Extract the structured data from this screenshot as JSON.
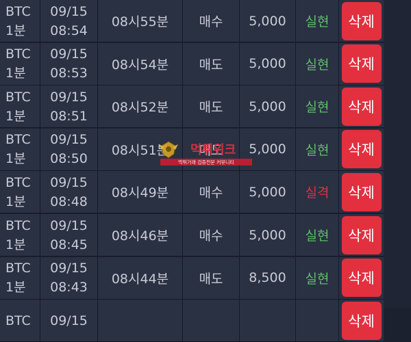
{
  "rows": [
    {
      "symbol": "BTC",
      "interval": "1분",
      "date": "09/15",
      "clock": "08:54",
      "round": "08시55분",
      "side": "매수",
      "amount": "5,000",
      "result": "실현",
      "result_type": "win",
      "action": "삭제"
    },
    {
      "symbol": "BTC",
      "interval": "1분",
      "date": "09/15",
      "clock": "08:53",
      "round": "08시54분",
      "side": "매도",
      "amount": "5,000",
      "result": "실현",
      "result_type": "win",
      "action": "삭제"
    },
    {
      "symbol": "BTC",
      "interval": "1분",
      "date": "09/15",
      "clock": "08:51",
      "round": "08시52분",
      "side": "매도",
      "amount": "5,000",
      "result": "실현",
      "result_type": "win",
      "action": "삭제"
    },
    {
      "symbol": "BTC",
      "interval": "1분",
      "date": "09/15",
      "clock": "08:50",
      "round": "08시51분",
      "side": "매도",
      "amount": "5,000",
      "result": "실현",
      "result_type": "win",
      "action": "삭제"
    },
    {
      "symbol": "BTC",
      "interval": "1분",
      "date": "09/15",
      "clock": "08:48",
      "round": "08시49분",
      "side": "매수",
      "amount": "5,000",
      "result": "실격",
      "result_type": "loss",
      "action": "삭제"
    },
    {
      "symbol": "BTC",
      "interval": "1분",
      "date": "09/15",
      "clock": "08:45",
      "round": "08시46분",
      "side": "매수",
      "amount": "5,000",
      "result": "실현",
      "result_type": "win",
      "action": "삭제"
    },
    {
      "symbol": "BTC",
      "interval": "1분",
      "date": "09/15",
      "clock": "08:43",
      "round": "08시44분",
      "side": "매도",
      "amount": "8,500",
      "result": "실현",
      "result_type": "win",
      "action": "삭제"
    },
    {
      "symbol": "BTC",
      "interval": "",
      "date": "09/15",
      "clock": "",
      "round": "",
      "side": "",
      "amount": "",
      "result": "",
      "result_type": "win",
      "action": "삭제"
    }
  ],
  "watermark": {
    "title": "먹튀위크",
    "subtitle": "먹튀거래 검증전문 커뮤니티"
  },
  "colors": {
    "win": "#5fbf6a",
    "loss": "#e2303f",
    "button": "#e2303f",
    "row_bg": "#2a3143"
  },
  "icons": {
    "watermark_emblem": "gold-wing-badge-icon"
  }
}
